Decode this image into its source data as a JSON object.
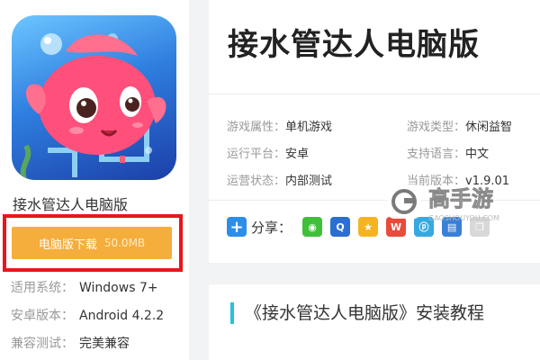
{
  "app": {
    "name": "接水管达人电脑版",
    "download_label": "电脑版下载",
    "download_size": "50.0MB",
    "specs": [
      {
        "label": "适用系统：",
        "value": "Windows 7+"
      },
      {
        "label": "安卓版本：",
        "value": "Android 4.2.2"
      },
      {
        "label": "兼容测试：",
        "value": "完美兼容"
      }
    ]
  },
  "detail": {
    "title": "接水管达人电脑版",
    "attributes": [
      {
        "label": "游戏属性：",
        "value": "单机游戏"
      },
      {
        "label": "游戏类型：",
        "value": "休闲益智"
      },
      {
        "label": "运行平台：",
        "value": "安卓"
      },
      {
        "label": "支持语言：",
        "value": "中文"
      },
      {
        "label": "运营状态：",
        "value": "内部测试"
      },
      {
        "label": "当前版本：",
        "value": "v1.9.01"
      }
    ],
    "share_label": "分享："
  },
  "section": {
    "title": "《接水管达人电脑版》安装教程"
  },
  "watermark": {
    "brand": "高手游",
    "domain": "GAOSHOUYOU.COM"
  },
  "colors": {
    "download_button": "#f5ad3c",
    "highlight_frame": "#e8161a",
    "section_accent": "#24c4d4"
  }
}
